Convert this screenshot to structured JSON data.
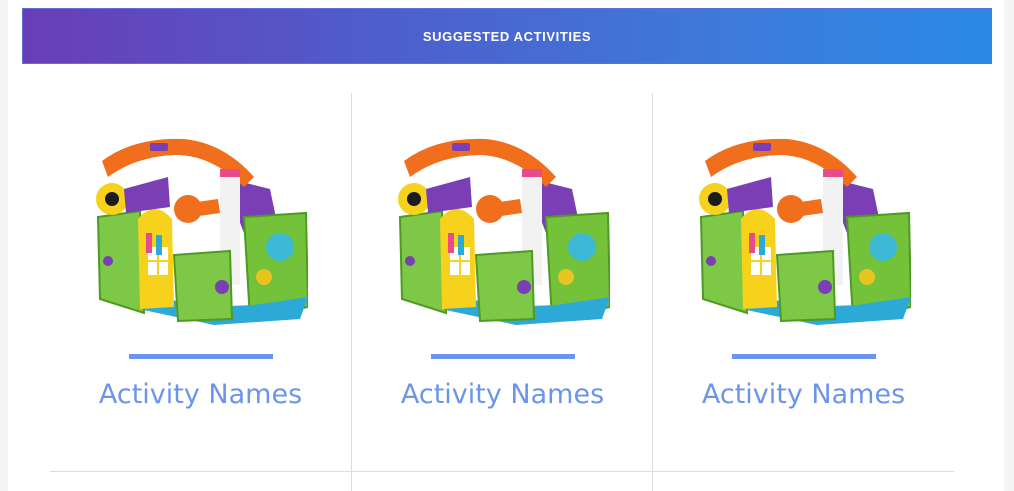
{
  "banner": {
    "title": "SUGGESTED ACTIVITIES"
  },
  "cards": [
    {
      "name": "Activity Names",
      "image": "activity-garden-toy"
    },
    {
      "name": "Activity Names",
      "image": "activity-garden-toy"
    },
    {
      "name": "Activity Names",
      "image": "activity-garden-toy"
    }
  ],
  "colors": {
    "accent": "#6b95ec",
    "banner_start": "#6a3db8",
    "banner_end": "#2b8ae6",
    "divider": "#dddddd"
  }
}
